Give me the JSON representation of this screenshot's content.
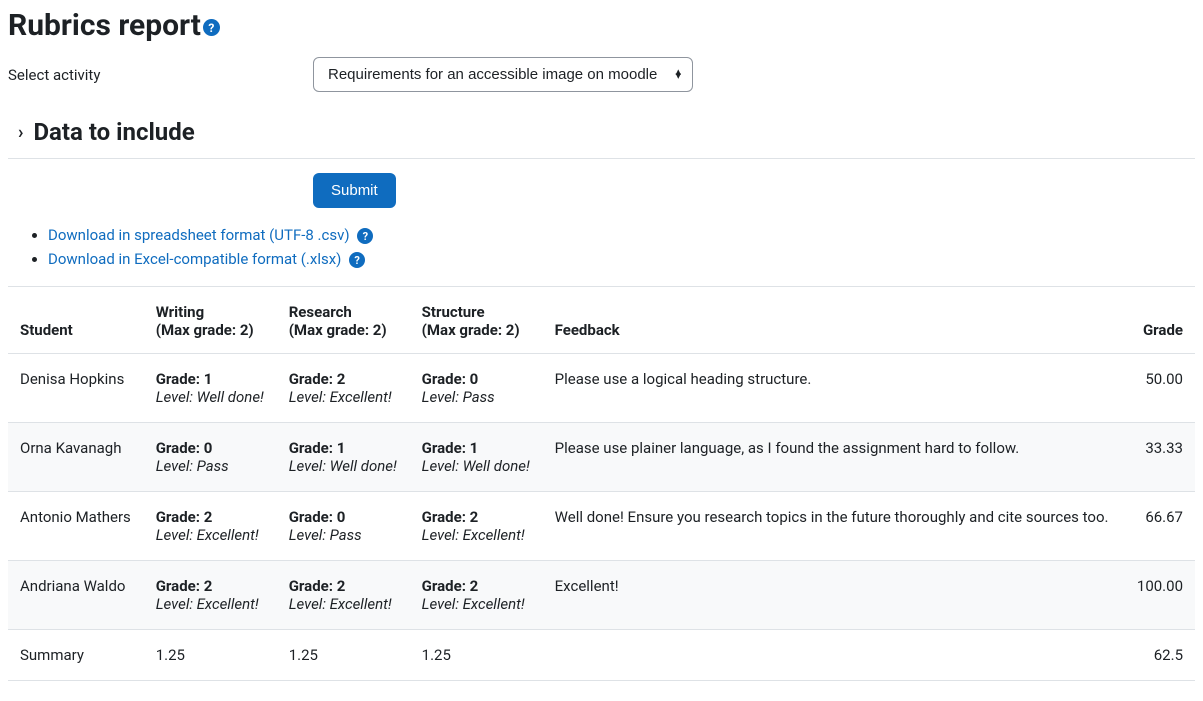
{
  "page": {
    "title": "Rubrics report",
    "select_label": "Select activity",
    "activity_selected": "Requirements for an accessible image on moodle",
    "data_to_include": "Data to include",
    "submit": "Submit"
  },
  "downloads": [
    {
      "label": "Download in spreadsheet format (UTF-8 .csv)"
    },
    {
      "label": "Download in Excel-compatible format (.xlsx)"
    }
  ],
  "table": {
    "headers": {
      "student": "Student",
      "writing_l1": "Writing",
      "writing_l2": "(Max grade: 2)",
      "research_l1": "Research",
      "research_l2": "(Max grade: 2)",
      "structure_l1": "Structure",
      "structure_l2": "(Max grade: 2)",
      "feedback": "Feedback",
      "grade": "Grade"
    },
    "rows": [
      {
        "student": "Denisa Hopkins",
        "writing_grade": "Grade: 1",
        "writing_level": "Level: Well done!",
        "research_grade": "Grade: 2",
        "research_level": "Level: Excellent!",
        "structure_grade": "Grade: 0",
        "structure_level": "Level: Pass",
        "feedback": "Please use a logical heading structure.",
        "grade": "50.00"
      },
      {
        "student": "Orna Kavanagh",
        "writing_grade": "Grade: 0",
        "writing_level": "Level: Pass",
        "research_grade": "Grade: 1",
        "research_level": "Level: Well done!",
        "structure_grade": "Grade: 1",
        "structure_level": "Level: Well done!",
        "feedback": "Please use plainer language, as I found the assignment hard to follow.",
        "grade": "33.33"
      },
      {
        "student": "Antonio Mathers",
        "writing_grade": "Grade: 2",
        "writing_level": "Level: Excellent!",
        "research_grade": "Grade: 0",
        "research_level": "Level: Pass",
        "structure_grade": "Grade: 2",
        "structure_level": "Level: Excellent!",
        "feedback": "Well done! Ensure you research topics in the future thoroughly and cite sources too.",
        "grade": "66.67"
      },
      {
        "student": "Andriana Waldo",
        "writing_grade": "Grade: 2",
        "writing_level": "Level: Excellent!",
        "research_grade": "Grade: 2",
        "research_level": "Level: Excellent!",
        "structure_grade": "Grade: 2",
        "structure_level": "Level: Excellent!",
        "feedback": "Excellent!",
        "grade": "100.00"
      }
    ],
    "summary": {
      "label": "Summary",
      "writing": "1.25",
      "research": "1.25",
      "structure": "1.25",
      "grade": "62.5"
    }
  }
}
